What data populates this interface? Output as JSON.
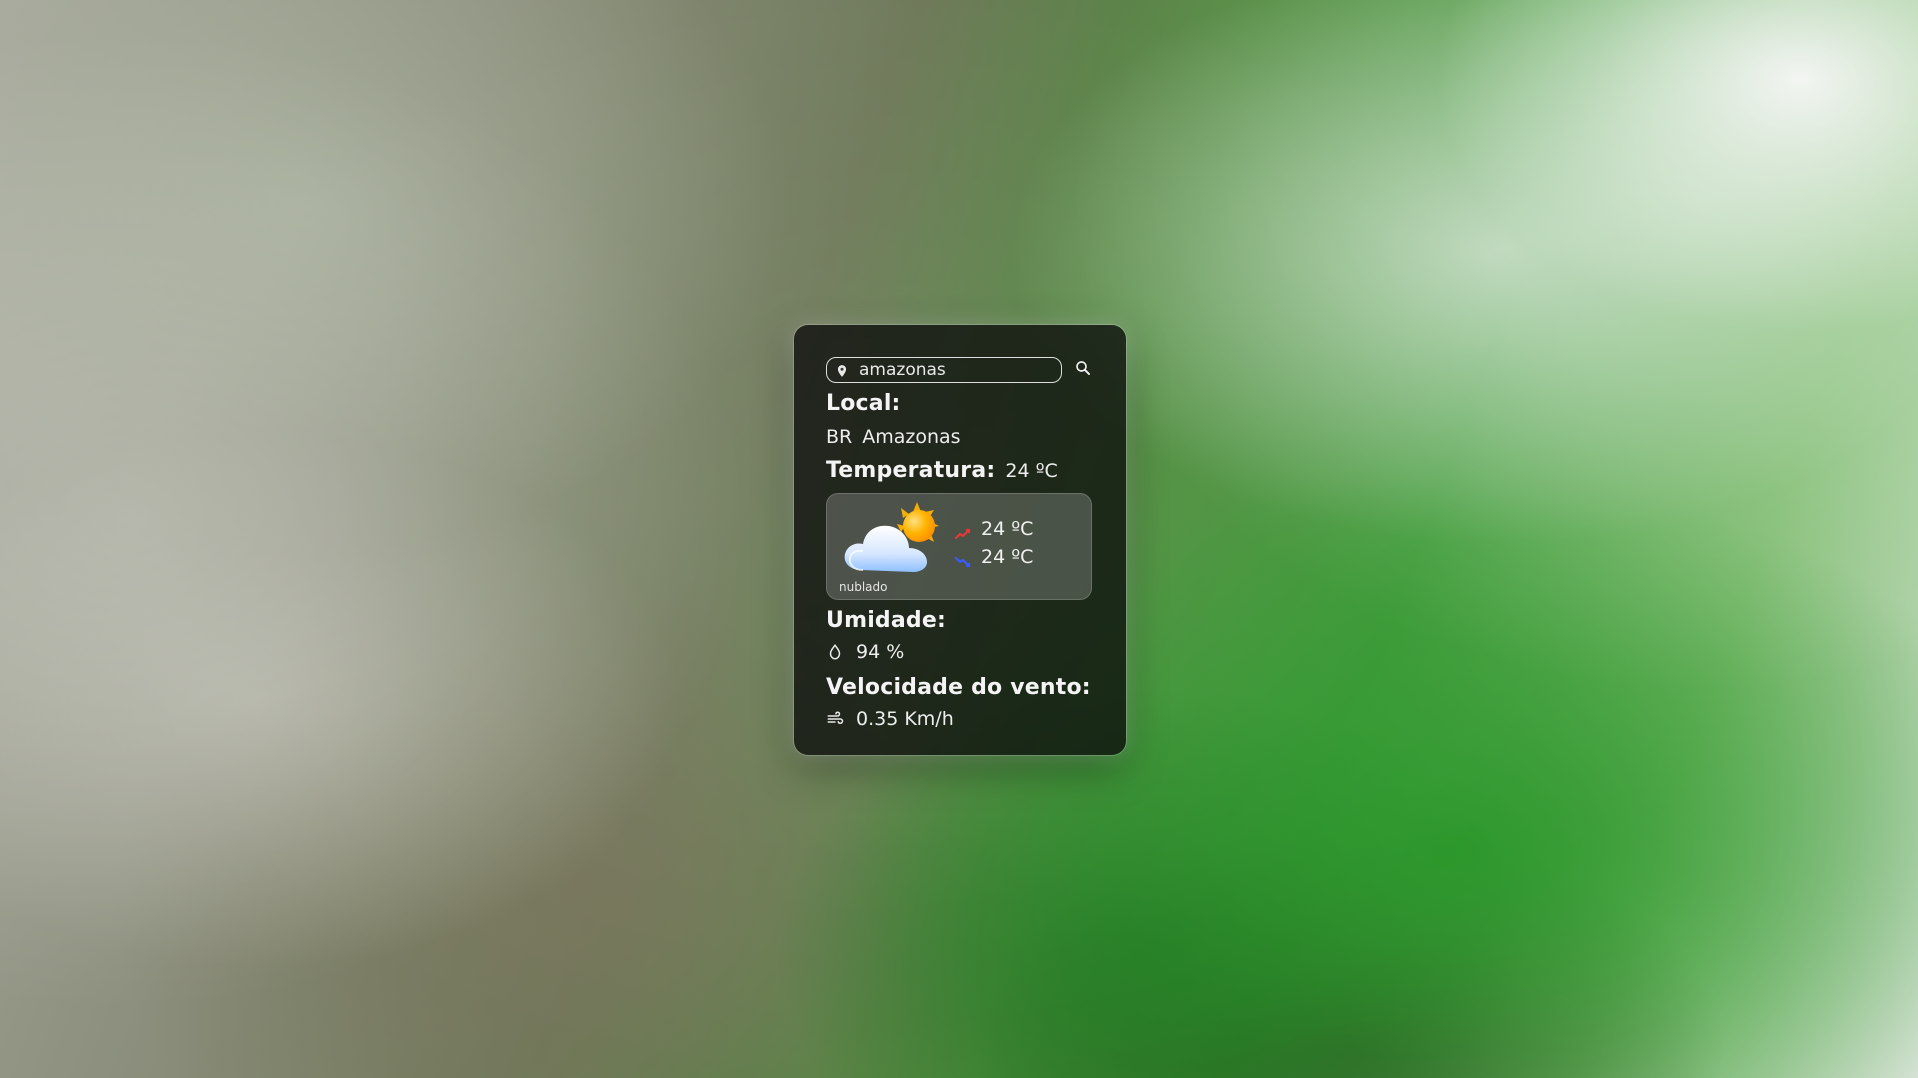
{
  "search": {
    "value": "amazonas",
    "pin_icon": "location-pin-icon",
    "search_icon": "search-icon"
  },
  "location": {
    "title": "Local:",
    "country": "BR",
    "name": "Amazonas"
  },
  "temperature": {
    "title": "Temperatura:",
    "current": "24 ºC",
    "max": "24 ºC",
    "min": "24 ºC",
    "max_icon": "trend-up-icon",
    "min_icon": "trend-down-icon",
    "condition": "nublado",
    "condition_icon": "partly-cloudy-icon"
  },
  "humidity": {
    "title": "Umidade:",
    "value": "94 %",
    "icon": "droplet-icon"
  },
  "wind": {
    "title": "Velocidade do vento:",
    "value": "0.35 Km/h",
    "icon": "wind-icon"
  },
  "colors": {
    "card_background": "#0c0c0cc7",
    "trend_up": "#e53935",
    "trend_down": "#3d5afe",
    "sun": "#ffb300",
    "cloud": "#dbe9ff"
  }
}
